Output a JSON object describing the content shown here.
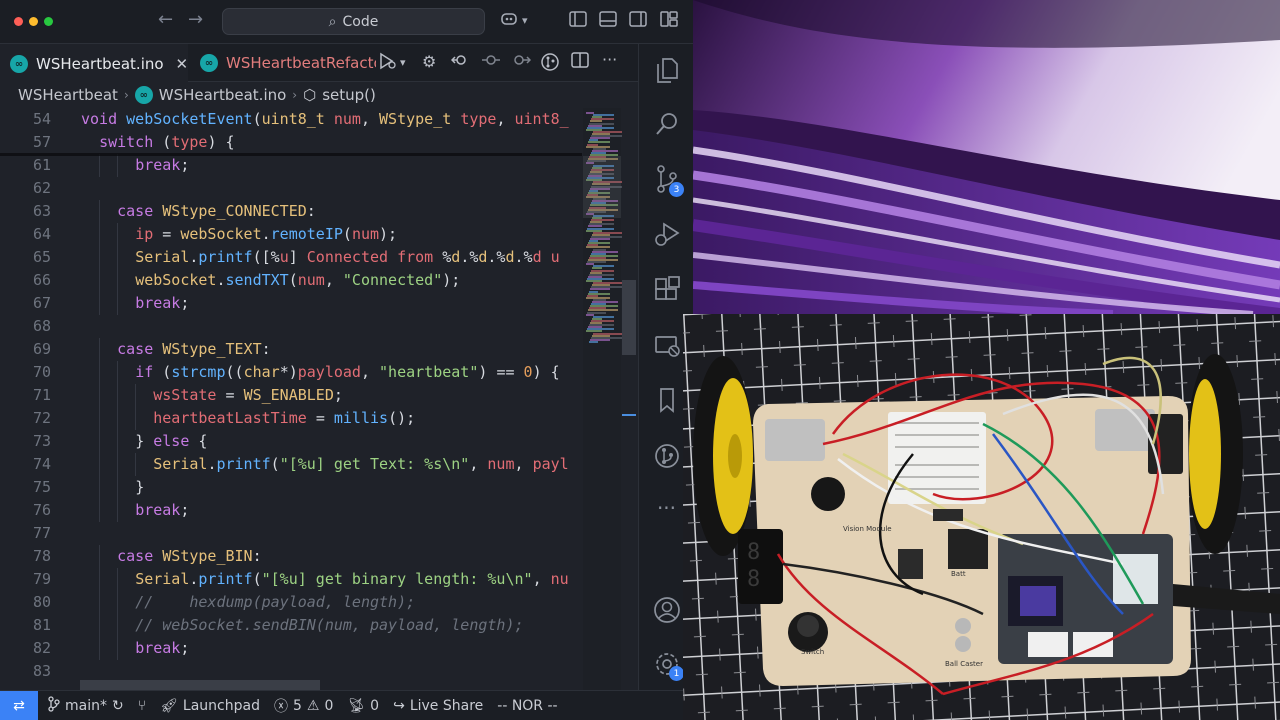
{
  "window": {
    "search_label": "Code"
  },
  "tabs": [
    {
      "label": "WSHeartbeat.ino",
      "active": true
    },
    {
      "label": "WSHeartbeatRefacto",
      "active": false
    }
  ],
  "breadcrumb": {
    "folder": "WSHeartbeat",
    "file": "WSHeartbeat.ino",
    "symbol": "setup()"
  },
  "editor": {
    "sticky_lines": [
      {
        "num": "54",
        "text": "void webSocketEvent(uint8_t num, WStype_t type, uint8_"
      },
      {
        "num": "57",
        "text": "  switch (type) {"
      }
    ],
    "lines": [
      {
        "num": "61",
        "text": "      break;"
      },
      {
        "num": "62",
        "text": ""
      },
      {
        "num": "63",
        "text": "    case WStype_CONNECTED:"
      },
      {
        "num": "64",
        "text": "      ip = webSocket.remoteIP(num);"
      },
      {
        "num": "65",
        "text": "      Serial.printf(\"[%u] Connected from %d.%d.%d.%d u"
      },
      {
        "num": "66",
        "text": "      webSocket.sendTXT(num, \"Connected\");"
      },
      {
        "num": "67",
        "text": "      break;"
      },
      {
        "num": "68",
        "text": ""
      },
      {
        "num": "69",
        "text": "    case WStype_TEXT:"
      },
      {
        "num": "70",
        "text": "      if (strcmp((char*)payload, \"heartbeat\") == 0) {"
      },
      {
        "num": "71",
        "text": "        wsState = WS_ENABLED;"
      },
      {
        "num": "72",
        "text": "        heartbeatLastTime = millis();"
      },
      {
        "num": "73",
        "text": "      } else {"
      },
      {
        "num": "74",
        "text": "        Serial.printf(\"[%u] get Text: %s\\n\", num, payl"
      },
      {
        "num": "75",
        "text": "      }"
      },
      {
        "num": "76",
        "text": "      break;"
      },
      {
        "num": "77",
        "text": ""
      },
      {
        "num": "78",
        "text": "    case WStype_BIN:"
      },
      {
        "num": "79",
        "text": "      Serial.printf(\"[%u] get binary length: %u\\n\", nu"
      },
      {
        "num": "80",
        "text": "      //    hexdump(payload, length);"
      },
      {
        "num": "81",
        "text": "      // webSocket.sendBIN(num, payload, length);"
      },
      {
        "num": "82",
        "text": "      break;"
      },
      {
        "num": "83",
        "text": ""
      }
    ]
  },
  "activity_bar": {
    "items": [
      "explorer-icon",
      "search-icon",
      "source-control-icon",
      "run-debug-icon",
      "extensions-icon",
      "remote-explorer-icon",
      "bookmarks-icon",
      "git-graph-icon",
      "more-icon",
      "account-icon",
      "settings-icon"
    ],
    "source_control_badge": "3",
    "settings_badge": "1"
  },
  "statusbar": {
    "branch": "main*",
    "launchpad": "Launchpad",
    "errors": "5",
    "warnings": "0",
    "ports": "0",
    "live_share": "Live Share",
    "vim_mode": "-- NOR --"
  },
  "camera": {
    "labels": [
      "Vision Module",
      "Switch",
      "Ball Caster",
      "Batt"
    ]
  },
  "colors": {
    "editor_bg": "#1f2229",
    "accent": "#3b82f6",
    "keyword": "#c67be3",
    "function": "#62b3ff",
    "string": "#9dd283"
  }
}
